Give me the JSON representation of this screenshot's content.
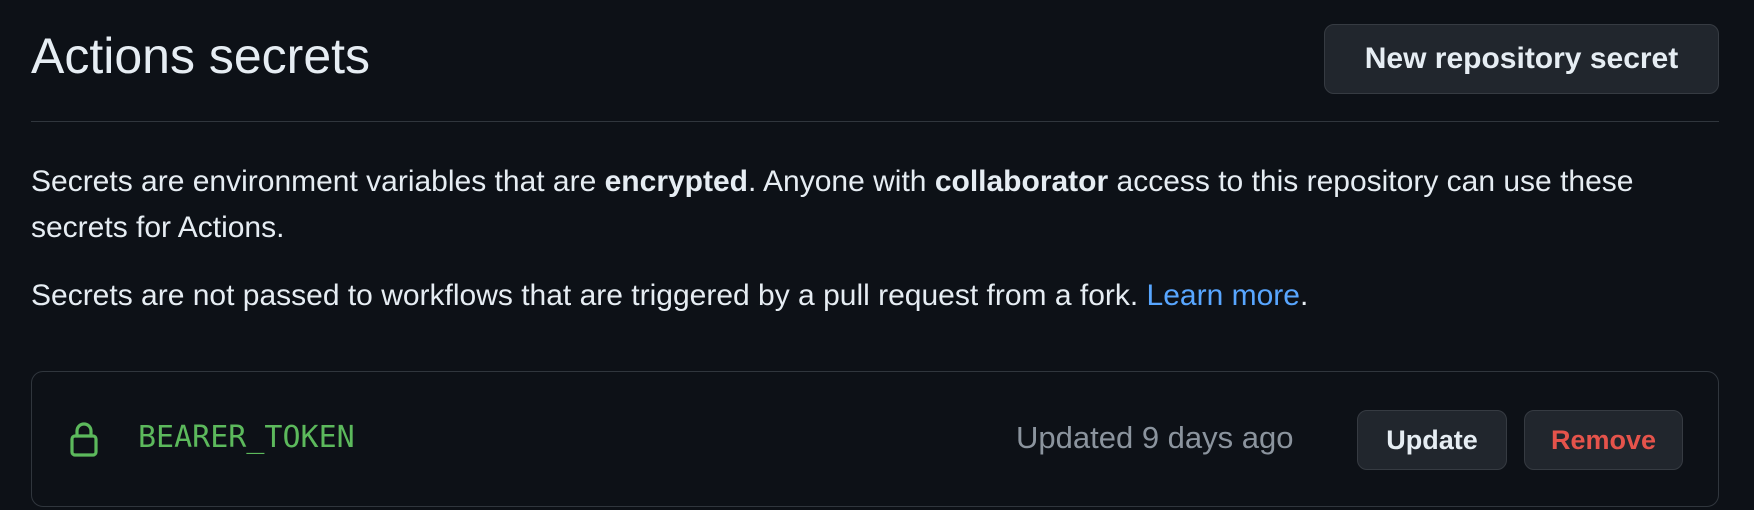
{
  "page": {
    "title": "Actions secrets",
    "new_secret_button": "New repository secret"
  },
  "description": {
    "line1_part1": "Secrets are environment variables that are ",
    "line1_bold1": "encrypted",
    "line1_part2": ". Anyone with ",
    "line1_bold2": "collaborator",
    "line1_part3": " access to this repository can use these secrets for Actions.",
    "line2_text": "Secrets are not passed to workflows that are triggered by a pull request from a fork. ",
    "line2_link": "Learn more",
    "line2_end": "."
  },
  "secrets": [
    {
      "icon": "lock-icon",
      "name": "BEARER_TOKEN",
      "updated": "Updated 9 days ago",
      "update_label": "Update",
      "remove_label": "Remove"
    }
  ],
  "colors": {
    "background": "#0d1117",
    "secret_name": "#5cb95c",
    "link": "#58a6ff",
    "remove": "#e5534b"
  }
}
